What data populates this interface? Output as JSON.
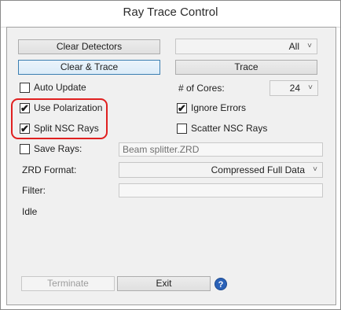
{
  "window": {
    "title": "Ray Trace Control"
  },
  "buttons": {
    "clear_detectors": "Clear Detectors",
    "clear_trace": "Clear & Trace",
    "trace": "Trace",
    "terminate": "Terminate",
    "exit": "Exit",
    "help_icon": "?"
  },
  "detector_select": {
    "value": "All"
  },
  "options": {
    "auto_update": {
      "label": "Auto Update",
      "checked": false
    },
    "use_polarization": {
      "label": "Use Polarization",
      "checked": true
    },
    "split_nsc_rays": {
      "label": "Split NSC Rays",
      "checked": true
    },
    "ignore_errors": {
      "label": "Ignore Errors",
      "checked": true
    },
    "scatter_nsc_rays": {
      "label": "Scatter NSC Rays",
      "checked": false
    },
    "save_rays": {
      "label": "Save Rays:",
      "checked": false
    }
  },
  "cores": {
    "label": "# of Cores:",
    "value": "24"
  },
  "save_rays_file": {
    "value": "Beam splitter.ZRD"
  },
  "zrd_format": {
    "label": "ZRD Format:",
    "value": "Compressed Full Data"
  },
  "filter": {
    "label": "Filter:",
    "value": ""
  },
  "status": {
    "text": "Idle"
  },
  "icons": {
    "checkmark": "✔",
    "chevron": "˅"
  },
  "colors": {
    "highlight": "#e02020",
    "focus_border": "#3c7fb1",
    "help_icon": "#2b62b8"
  }
}
